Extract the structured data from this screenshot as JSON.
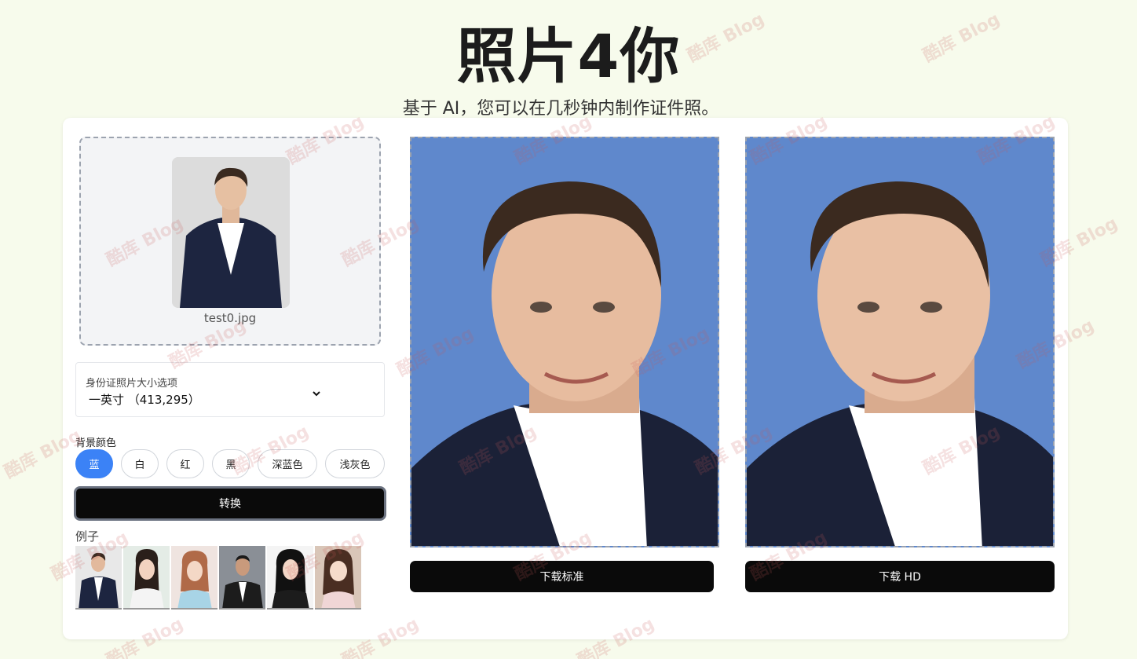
{
  "header": {
    "title": "照片4你",
    "subtitle": "基于 AI，您可以在几秒钟内制作证件照。"
  },
  "upload": {
    "filename": "test0.jpg"
  },
  "size_select": {
    "label": "身份证照片大小选项",
    "value": "一英寸 （413,295）"
  },
  "background": {
    "label": "背景颜色",
    "options": [
      "蓝",
      "白",
      "红",
      "黑",
      "深蓝色",
      "浅灰色"
    ],
    "selected": "蓝"
  },
  "convert_label": "转换",
  "examples_label": "例子",
  "downloads": {
    "standard_label": "下载标准",
    "hd_label": "下载 HD"
  },
  "watermark": "酷库 Blog",
  "colors": {
    "accent": "#3b82f6",
    "result_bg": "#5f88cc",
    "page_bg": "#f7fbec"
  }
}
